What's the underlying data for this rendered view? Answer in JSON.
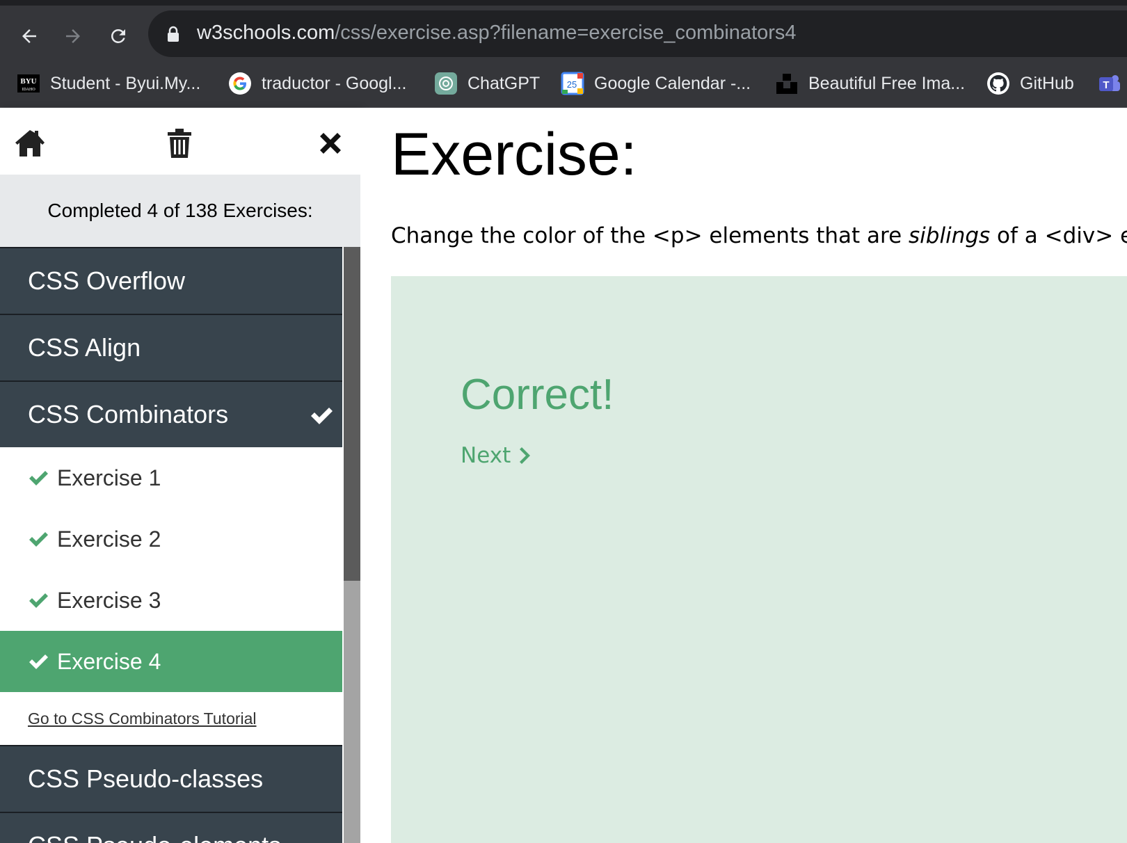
{
  "browser": {
    "url_domain": "w3schools.com",
    "url_path": "/css/exercise.asp?filename=exercise_combinators4",
    "nav_icons": [
      "back-icon",
      "forward-icon",
      "reload-icon"
    ],
    "bookmarks": [
      {
        "label": "Student - Byui.My...",
        "icon": "byu-icon",
        "icon_text": "BYU IDAHO"
      },
      {
        "label": "traductor - Googl...",
        "icon": "google-icon"
      },
      {
        "label": "ChatGPT",
        "icon": "chatgpt-icon"
      },
      {
        "label": "Google Calendar -...",
        "icon": "calendar-icon",
        "icon_text": "25"
      },
      {
        "label": "Beautiful Free Ima...",
        "icon": "unsplash-icon"
      },
      {
        "label": "GitHub",
        "icon": "github-icon"
      },
      {
        "label": "",
        "icon": "teams-icon",
        "icon_text": "T"
      }
    ]
  },
  "sidebar": {
    "icons": [
      "home-icon",
      "trash-icon",
      "close-icon"
    ],
    "completed_text": "Completed 4 of 138 Exercises:",
    "categories_before": [
      "CSS Overflow",
      "CSS Align"
    ],
    "active_category": "CSS Combinators",
    "exercises": [
      {
        "label": "Exercise 1",
        "done": true,
        "active": false
      },
      {
        "label": "Exercise 2",
        "done": true,
        "active": false
      },
      {
        "label": "Exercise 3",
        "done": true,
        "active": false
      },
      {
        "label": "Exercise 4",
        "done": true,
        "active": true
      }
    ],
    "tutorial_link": "Go to CSS Combinators Tutorial",
    "categories_after": [
      "CSS Pseudo-classes",
      "CSS Pseudo-elements"
    ]
  },
  "main": {
    "title": "Exercise:",
    "desc_before": "Change the color of the <p> elements that are ",
    "desc_em": "siblings",
    "desc_after": " of a <div> ele",
    "result_text": "Correct!",
    "next_label": "Next"
  },
  "colors": {
    "chrome_bg": "#35363a",
    "url_bg": "#202124",
    "category_bg": "#38444d",
    "accent_green": "#4ea570",
    "result_bg": "#dcece2",
    "completed_bg": "#e7e9eb"
  }
}
